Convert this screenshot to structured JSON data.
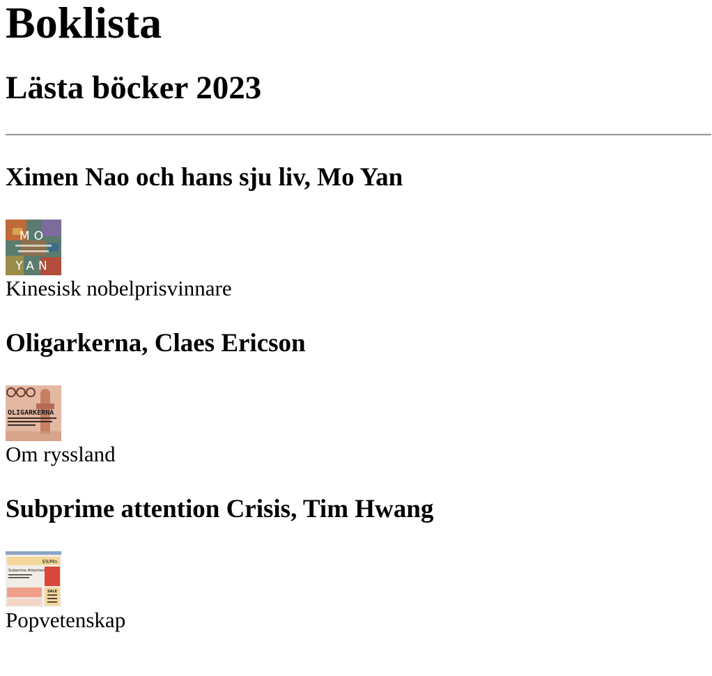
{
  "page": {
    "title": "Boklista",
    "subtitle": "Lästa böcker 2023"
  },
  "books": [
    {
      "heading": "Ximen Nao och hans sju liv, Mo Yan",
      "description": "Kinesisk nobelprisvinnare",
      "cover_icon": "book-cover-mo-yan"
    },
    {
      "heading": "Oligarkerna, Claes Ericson",
      "description": "Om ryssland",
      "cover_icon": "book-cover-oligarkerna"
    },
    {
      "heading": "Subprime attention Crisis, Tim Hwang",
      "description": "Popvetenskap",
      "cover_icon": "book-cover-subprime"
    }
  ],
  "colors": {
    "cover1_bg": "#4f7a6a",
    "cover2_bg": "#d9a08a",
    "cover3_bg": "#f1ede6"
  },
  "cover_text": {
    "mo_yan_top": "MO",
    "mo_yan_bottom": "YAN",
    "oligarkerna": "OLIGARKERNA",
    "subprime_price": "$9/Mo.",
    "subprime_title": "Subprime Attention Crisis",
    "subprime_sale": "SALE"
  }
}
